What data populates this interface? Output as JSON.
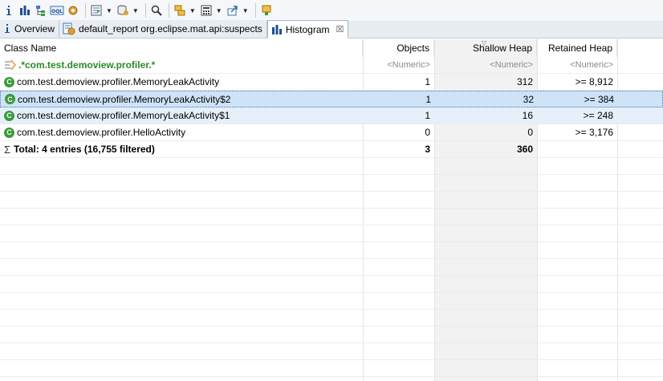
{
  "toolbar": {
    "icons": [
      "info-icon",
      "bar-chart-icon",
      "dominator-tree-icon",
      "oql-icon",
      "gear-icon",
      "query-browser-icon",
      "heap-dump-icon",
      "search-icon",
      "group-by-icon",
      "calculator-icon",
      "export-icon",
      "pin-icon"
    ],
    "oql_label": "OQL"
  },
  "tabs": [
    {
      "label": "Overview",
      "icon": "info-icon",
      "active": false
    },
    {
      "label": "default_report  org.eclipse.mat.api:suspects",
      "icon": "report-icon",
      "active": false
    },
    {
      "label": "Histogram",
      "icon": "bar-chart-icon",
      "active": true,
      "close": "☒"
    }
  ],
  "table": {
    "columns": [
      "Class Name",
      "Objects",
      "Shallow Heap",
      "Retained Heap"
    ],
    "filter_row": {
      "name": ".*com.test.demoview.profiler.*",
      "objects": "<Numeric>",
      "shallow": "<Numeric>",
      "retained": "<Numeric>"
    },
    "rows": [
      {
        "name": "com.test.demoview.profiler.MemoryLeakActivity",
        "objects": "1",
        "shallow": "312",
        "retained": ">= 8,912"
      },
      {
        "name": "com.test.demoview.profiler.MemoryLeakActivity$2",
        "objects": "1",
        "shallow": "32",
        "retained": ">= 384"
      },
      {
        "name": "com.test.demoview.profiler.MemoryLeakActivity$1",
        "objects": "1",
        "shallow": "16",
        "retained": ">= 248"
      },
      {
        "name": "com.test.demoview.profiler.HelloActivity",
        "objects": "0",
        "shallow": "0",
        "retained": ">= 3,176"
      }
    ],
    "total": {
      "symbol": "Σ",
      "label": "Total: 4 entries (16,755 filtered)",
      "objects": "3",
      "shallow": "360",
      "retained": ""
    },
    "class_icon_letter": "C"
  },
  "colors": {
    "accent": "#3b9a3b",
    "selection": "#cfe3f7",
    "filter_text": "#2a8a2a"
  }
}
